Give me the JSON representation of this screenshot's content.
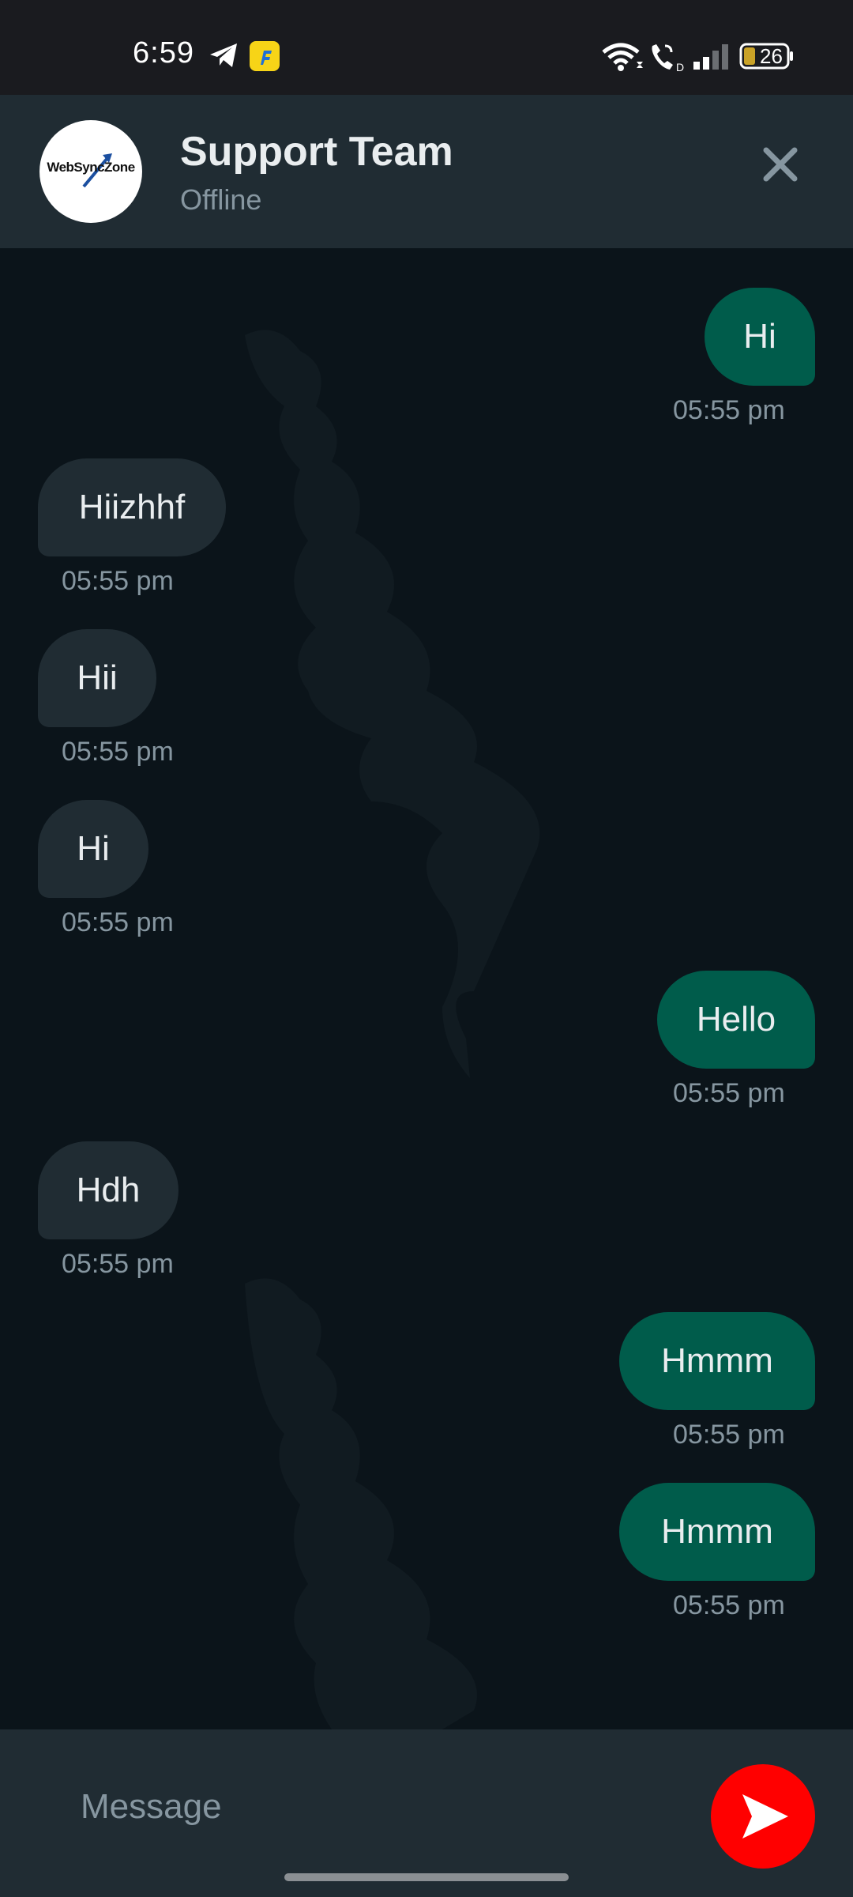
{
  "status_bar": {
    "time": "6:59",
    "battery": "26",
    "icons": [
      "telegram-icon",
      "flipkart-icon",
      "wifi-icon",
      "wifi-call-icon",
      "signal-icon",
      "battery-icon"
    ]
  },
  "header": {
    "avatar_logo_text": "WebSyncZone",
    "title": "Support Team",
    "status": "Offline",
    "close_icon": "close-icon"
  },
  "messages": [
    {
      "direction": "out",
      "text": "Hi",
      "time": "05:55 pm"
    },
    {
      "direction": "in",
      "text": "Hiizhhf",
      "time": "05:55 pm"
    },
    {
      "direction": "in",
      "text": "Hii",
      "time": "05:55 pm"
    },
    {
      "direction": "in",
      "text": "Hi",
      "time": "05:55 pm"
    },
    {
      "direction": "out",
      "text": "Hello",
      "time": "05:55 pm"
    },
    {
      "direction": "in",
      "text": "Hdh",
      "time": "05:55 pm"
    },
    {
      "direction": "out",
      "text": "Hmmm",
      "time": "05:55 pm"
    },
    {
      "direction": "out",
      "text": "Hmmm",
      "time": "05:55 pm"
    }
  ],
  "composer": {
    "placeholder": "Message",
    "value": "",
    "send_icon": "send-icon"
  },
  "colors": {
    "outgoing_bubble": "#005c4b",
    "incoming_bubble": "#202c33",
    "send_button": "#ff0000",
    "chat_background": "#0b141a"
  }
}
